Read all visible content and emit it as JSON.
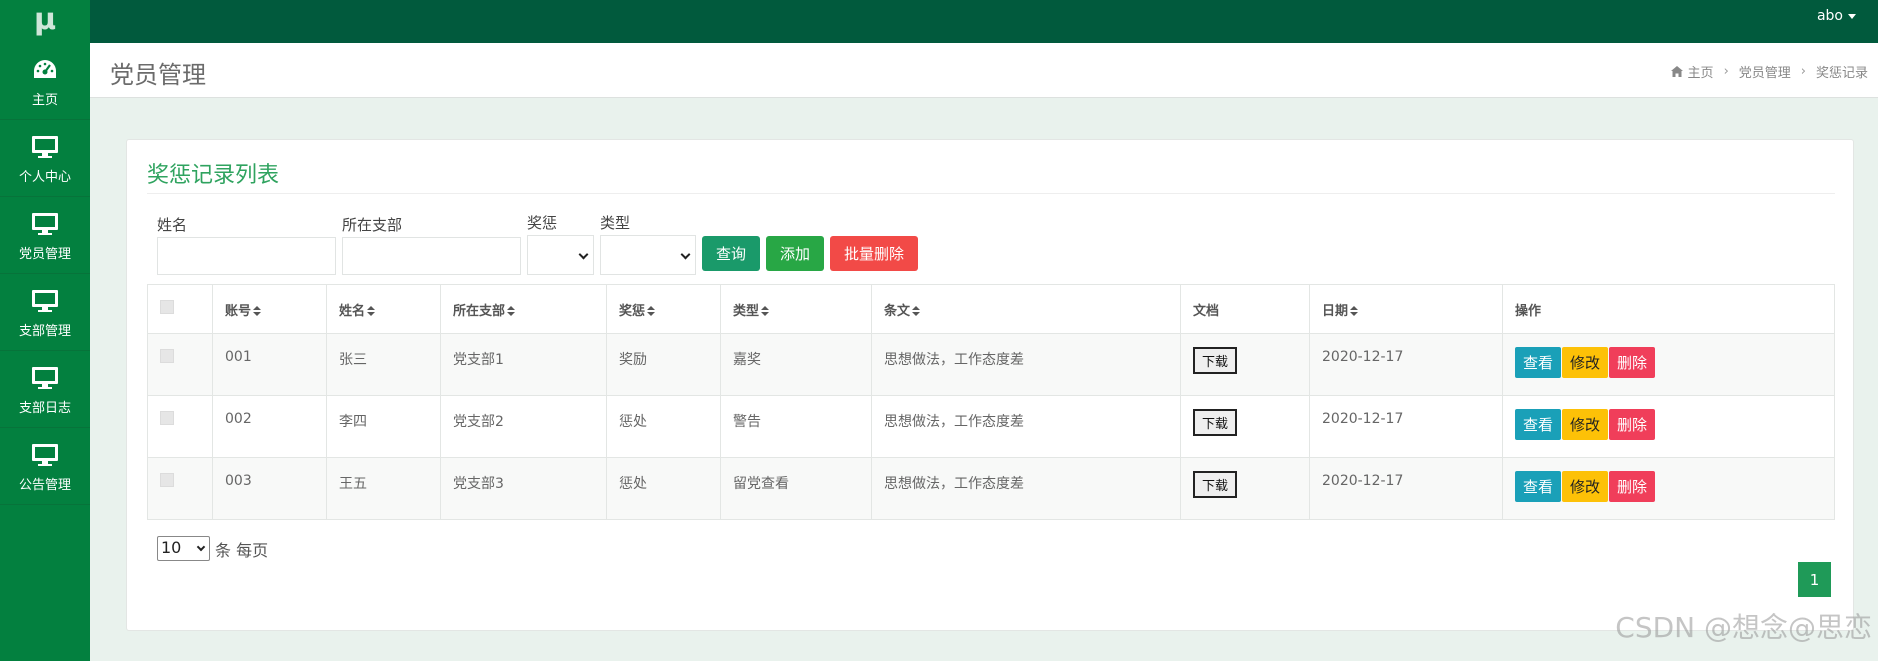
{
  "logo": "μ",
  "user": {
    "name": "abo"
  },
  "sidebar": {
    "items": [
      {
        "label": "主页",
        "icon": "dashboard-icon"
      },
      {
        "label": "个人中心",
        "icon": "monitor-icon"
      },
      {
        "label": "党员管理",
        "icon": "monitor-icon"
      },
      {
        "label": "支部管理",
        "icon": "monitor-icon"
      },
      {
        "label": "支部日志",
        "icon": "monitor-icon"
      },
      {
        "label": "公告管理",
        "icon": "monitor-icon"
      }
    ]
  },
  "header": {
    "title": "党员管理",
    "breadcrumb": [
      "主页",
      "党员管理",
      "奖惩记录"
    ]
  },
  "card": {
    "title": "奖惩记录列表",
    "filters": {
      "name_label": "姓名",
      "branch_label": "所在支部",
      "reward_label": "奖惩",
      "type_label": "类型"
    },
    "buttons": {
      "query": "查询",
      "add": "添加",
      "batch_delete": "批量删除"
    }
  },
  "table": {
    "headers": [
      "账号",
      "姓名",
      "所在支部",
      "奖惩",
      "类型",
      "条文",
      "文档",
      "日期",
      "操作"
    ],
    "rows": [
      {
        "account": "001",
        "name": "张三",
        "branch": "党支部1",
        "reward": "奖励",
        "type": "嘉奖",
        "clause": "思想做法，工作态度差",
        "doc": "下载",
        "date": "2020-12-17"
      },
      {
        "account": "002",
        "name": "李四",
        "branch": "党支部2",
        "reward": "惩处",
        "type": "警告",
        "clause": "思想做法，工作态度差",
        "doc": "下载",
        "date": "2020-12-17"
      },
      {
        "account": "003",
        "name": "王五",
        "branch": "党支部3",
        "reward": "惩处",
        "type": "留党查看",
        "clause": "思想做法，工作态度差",
        "doc": "下载",
        "date": "2020-12-17"
      }
    ],
    "actions": {
      "view": "查看",
      "edit": "修改",
      "delete": "删除"
    }
  },
  "pagination": {
    "page_size": "10",
    "per_page_label": "条 每页",
    "current_page": "1"
  },
  "watermark": "CSDN @想念@思恋",
  "colors": {
    "topbar": "#015a3d",
    "sidebar": "#03803f",
    "accent": "#2fa35f"
  }
}
